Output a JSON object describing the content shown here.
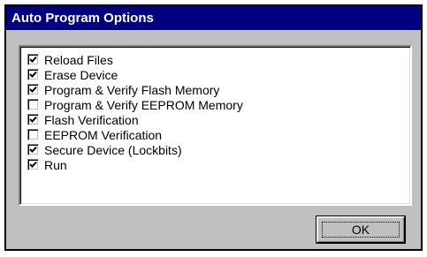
{
  "dialog": {
    "title": "Auto Program Options",
    "options": [
      {
        "label": "Reload Files",
        "checked": true
      },
      {
        "label": "Erase Device",
        "checked": true
      },
      {
        "label": "Program & Verify Flash Memory",
        "checked": true
      },
      {
        "label": "Program & Verify EEPROM Memory",
        "checked": false
      },
      {
        "label": "Flash Verification",
        "checked": true
      },
      {
        "label": "EEPROM Verification",
        "checked": false
      },
      {
        "label": "Secure Device (Lockbits)",
        "checked": true
      },
      {
        "label": "Run",
        "checked": true
      }
    ],
    "ok_label": "OK"
  },
  "colors": {
    "titlebar": "#000080",
    "face": "#c0c0c0",
    "list_background": "#ffffff"
  },
  "icons": {
    "checked": "checkmark-icon"
  }
}
